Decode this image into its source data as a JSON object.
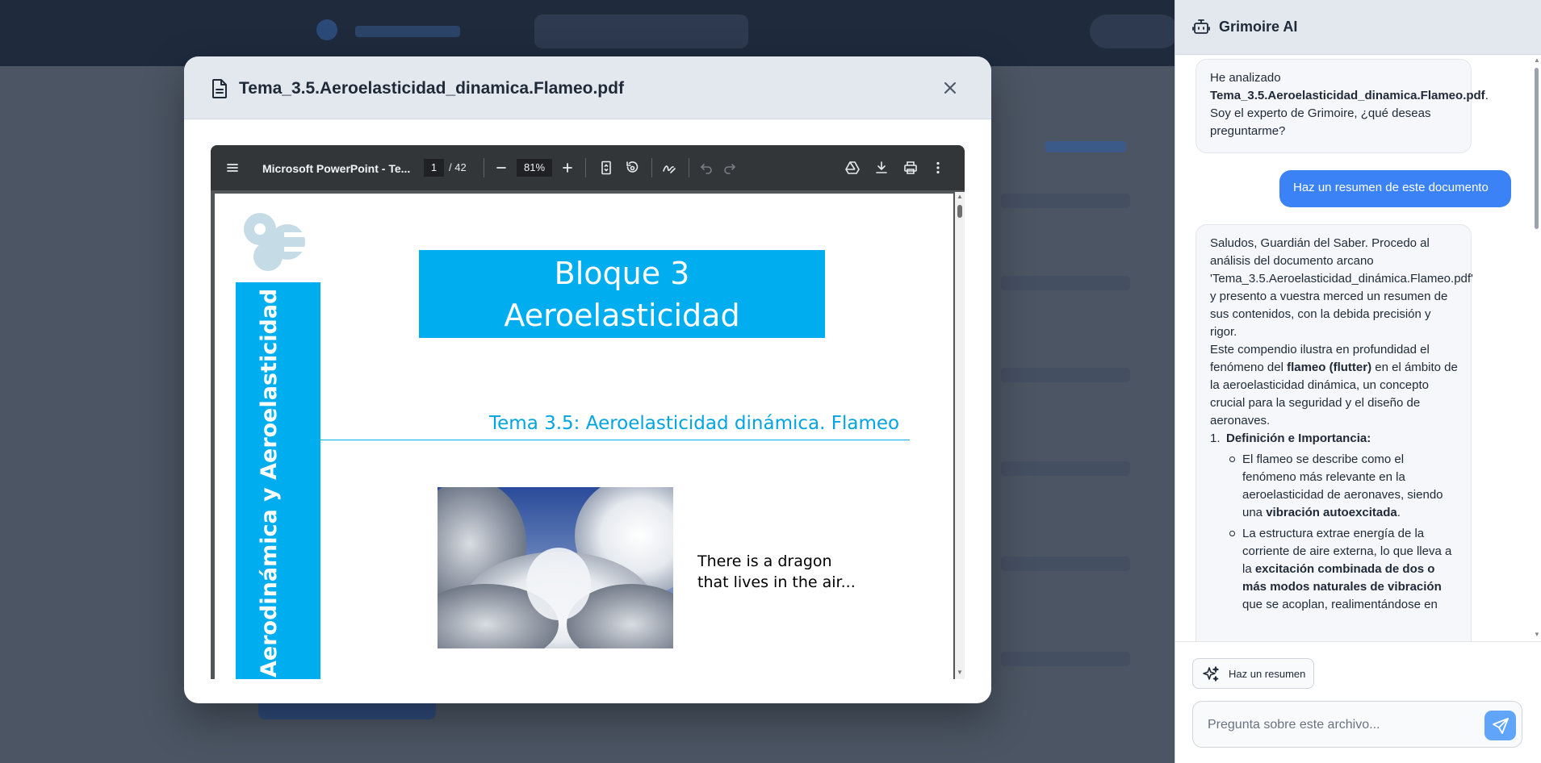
{
  "modal": {
    "title": "Tema_3.5.Aeroelasticidad_dinamica.Flameo.pdf"
  },
  "pdf_viewer": {
    "doc_title": "Microsoft PowerPoint - Te...",
    "current_page": "1",
    "page_total": "/ 42",
    "zoom": "81%"
  },
  "slide": {
    "title_line1": "Bloque 3",
    "title_line2": "Aeroelasticidad",
    "vertical_label": "Aerodinámica y Aeroelasticidad",
    "subtitle": "Tema 3.5: Aeroelasticidad dinámica. Flameo",
    "caption_line1": "There is a dragon",
    "caption_line2": "that lives in the air..."
  },
  "ai_panel": {
    "title": "Grimoire AI",
    "msg1": {
      "prefix": "He analizado",
      "filename": "Tema_3.5.Aeroelasticidad_dinamica.Flameo.pdf",
      "period": ".",
      "rest": "Soy el experto de Grimoire, ¿qué deseas preguntarme?"
    },
    "user_msg": "Haz un resumen de este documento",
    "msg2": {
      "para1": "Saludos, Guardián del Saber. Procedo al análisis del documento arcano 'Tema_3.5.Aeroelasticidad_dinámica.Flameo.pdf' y presento a vuestra merced un resumen de sus contenidos, con la debida precisión y rigor.",
      "para2_a": "Este compendio ilustra en profundidad el fenómeno del ",
      "para2_b": "flameo (flutter)",
      "para2_c": " en el ámbito de la aeroelasticidad dinámica, un concepto crucial para la seguridad y el diseño de aeronaves.",
      "list_num": "1.",
      "list_title": "Definición e Importancia:",
      "bullet1_a": "El flameo se describe como el fenómeno más relevante en la aeroelasticidad de aeronaves, siendo una ",
      "bullet1_b": "vibración autoexcitada",
      "bullet1_c": ".",
      "bullet2_a": "La estructura extrae energía de la corriente de aire externa, lo que lleva a la ",
      "bullet2_b": "excitación combinada de dos o más modos naturales de vibración",
      "bullet2_c": " que se acoplan, realimentándose en"
    },
    "chip_label": "Haz un resumen",
    "input_placeholder": "Pregunta sobre este archivo...",
    "accent_color": "#3b82f6"
  }
}
